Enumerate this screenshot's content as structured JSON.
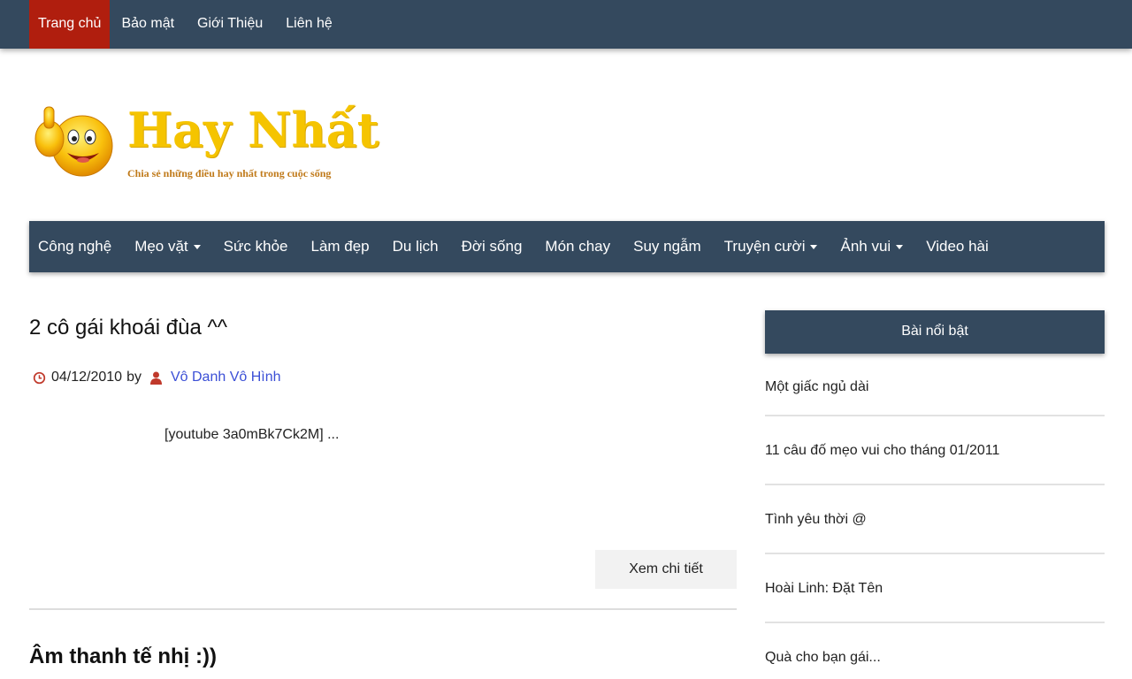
{
  "top_nav": {
    "items": [
      {
        "label": "Trang chủ",
        "active": true
      },
      {
        "label": "Bảo mật"
      },
      {
        "label": "Giới Thiệu"
      },
      {
        "label": "Liên hệ"
      }
    ]
  },
  "logo": {
    "title": "Hay Nhất",
    "tagline": "Chia sẻ những điều hay nhất trong cuộc sống"
  },
  "main_nav": {
    "items": [
      {
        "label": "Công nghệ",
        "dropdown": false
      },
      {
        "label": "Mẹo vặt",
        "dropdown": true
      },
      {
        "label": "Sức khỏe",
        "dropdown": false
      },
      {
        "label": "Làm đẹp",
        "dropdown": false
      },
      {
        "label": "Du lịch",
        "dropdown": false
      },
      {
        "label": "Đời sống",
        "dropdown": false
      },
      {
        "label": "Món chay",
        "dropdown": false
      },
      {
        "label": "Suy ngẫm",
        "dropdown": false
      },
      {
        "label": "Truyện cười",
        "dropdown": true
      },
      {
        "label": "Ảnh vui",
        "dropdown": true
      },
      {
        "label": "Video hài",
        "dropdown": false
      }
    ]
  },
  "posts": [
    {
      "title": "2 cô gái khoái đùa ^^",
      "date": "04/12/2010",
      "by": "by",
      "author": "Vô Danh Vô Hình",
      "excerpt": "[youtube 3a0mBk7Ck2M] ...",
      "read_more": "Xem chi tiết"
    },
    {
      "title": "Âm thanh tế nhị :))"
    }
  ],
  "sidebar": {
    "title": "Bài nổi bật",
    "items": [
      "Một giấc ngủ dài",
      "11 câu đố mẹo vui cho tháng 01/2011",
      "Tình yêu thời @",
      "Hoài Linh: Đặt Tên",
      "Quà cho bạn gái..."
    ]
  },
  "colors": {
    "nav_bg": "#34495e",
    "active_bg": "#b01e0e",
    "logo_yellow": "#f5c400",
    "author_link": "#3b4fd6",
    "meta_icon": "#c0392b"
  },
  "icons": {
    "date": "clock-icon",
    "author": "user-icon",
    "dropdown": "caret-down-icon"
  }
}
